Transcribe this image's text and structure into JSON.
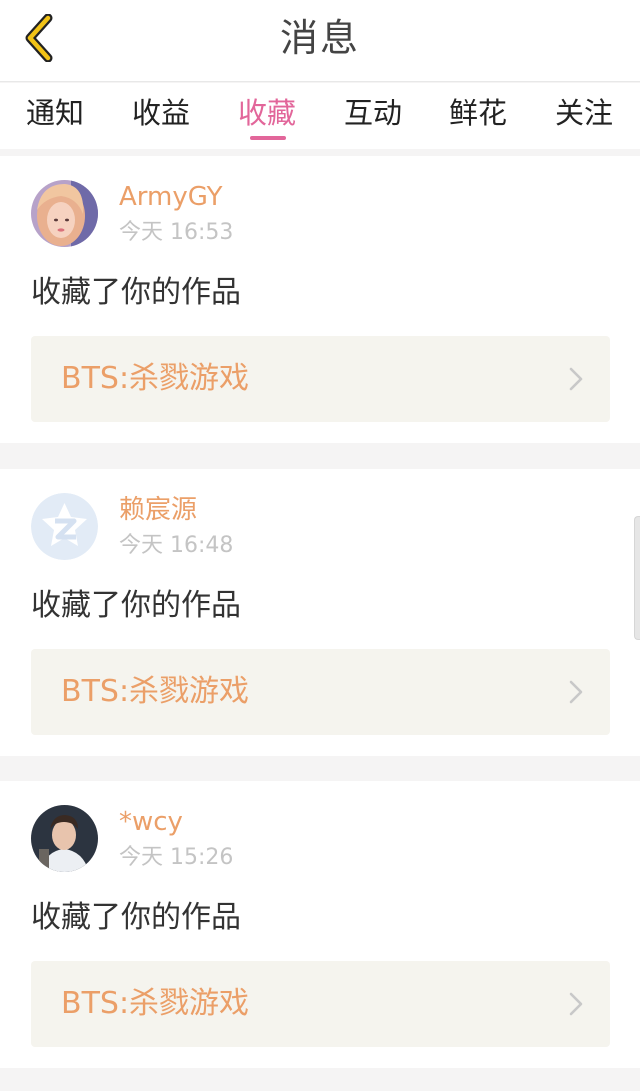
{
  "header": {
    "title": "消息",
    "back_icon": "chevron-left-icon"
  },
  "tabs": [
    {
      "label": "通知",
      "active": false
    },
    {
      "label": "收益",
      "active": false
    },
    {
      "label": "收藏",
      "active": true
    },
    {
      "label": "互动",
      "active": false
    },
    {
      "label": "鲜花",
      "active": false
    },
    {
      "label": "关注",
      "active": false
    }
  ],
  "colors": {
    "accent": "#e2669a",
    "name": "#eb9f68",
    "card_bg": "#f5f4ee",
    "time": "#c4c4c4"
  },
  "messages": [
    {
      "username": "ArmyGY",
      "time": "今天 16:53",
      "action": "收藏了你的作品",
      "work_title": "BTS:杀戮游戏"
    },
    {
      "username": "赖宸源",
      "time": "今天 16:48",
      "action": "收藏了你的作品",
      "work_title": "BTS:杀戮游戏"
    },
    {
      "username": "*wcy",
      "time": "今天 15:26",
      "action": "收藏了你的作品",
      "work_title": "BTS:杀戮游戏"
    }
  ]
}
